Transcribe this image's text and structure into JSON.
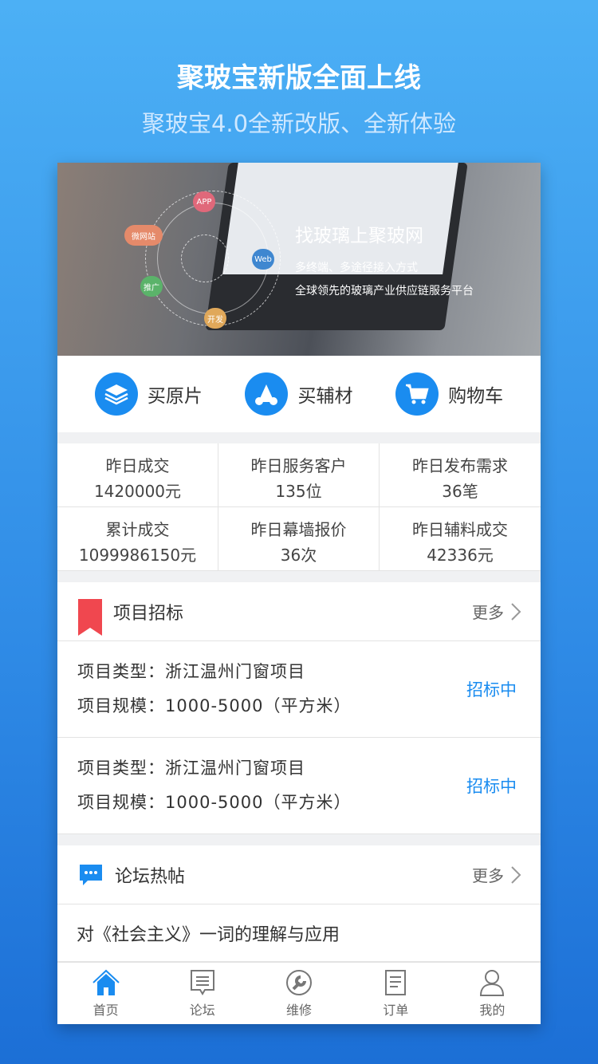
{
  "promo": {
    "title": "聚玻宝新版全面上线",
    "subtitle": "聚玻宝4.0全新改版、全新体验"
  },
  "banner": {
    "headline": "找玻璃上聚玻网",
    "line1": "多终端、多途径接入方式",
    "line2": "全球领先的玻璃产业供应链服务平台",
    "bubbles": [
      "APP",
      "微网站",
      "Web",
      "推广",
      "开发"
    ]
  },
  "quick": [
    {
      "label": "买原片",
      "icon": "layers-icon"
    },
    {
      "label": "买辅材",
      "icon": "materials-icon"
    },
    {
      "label": "购物车",
      "icon": "cart-icon"
    }
  ],
  "stats": [
    {
      "label": "昨日成交",
      "value": "1420000元"
    },
    {
      "label": "昨日服务客户",
      "value": "135位"
    },
    {
      "label": "昨日发布需求",
      "value": "36笔"
    },
    {
      "label": "累计成交",
      "value": "1099986150元"
    },
    {
      "label": "昨日幕墙报价",
      "value": "36次"
    },
    {
      "label": "昨日辅料成交",
      "value": "42336元"
    }
  ],
  "bidding": {
    "title": "项目招标",
    "more": "更多",
    "items": [
      {
        "type": "项目类型：浙江温州门窗项目",
        "scale": "项目规模：1000-5000（平方米）",
        "status": "招标中"
      },
      {
        "type": "项目类型：浙江温州门窗项目",
        "scale": "项目规模：1000-5000（平方米）",
        "status": "招标中"
      }
    ]
  },
  "forum": {
    "title": "论坛热帖",
    "more": "更多",
    "posts": [
      "对《社会主义》一词的理解与应用"
    ]
  },
  "tabs": [
    {
      "label": "首页",
      "active": true
    },
    {
      "label": "论坛"
    },
    {
      "label": "维修"
    },
    {
      "label": "订单"
    },
    {
      "label": "我的"
    }
  ],
  "colors": {
    "accent": "#1a8cf0",
    "bookmark": "#f0474f"
  }
}
